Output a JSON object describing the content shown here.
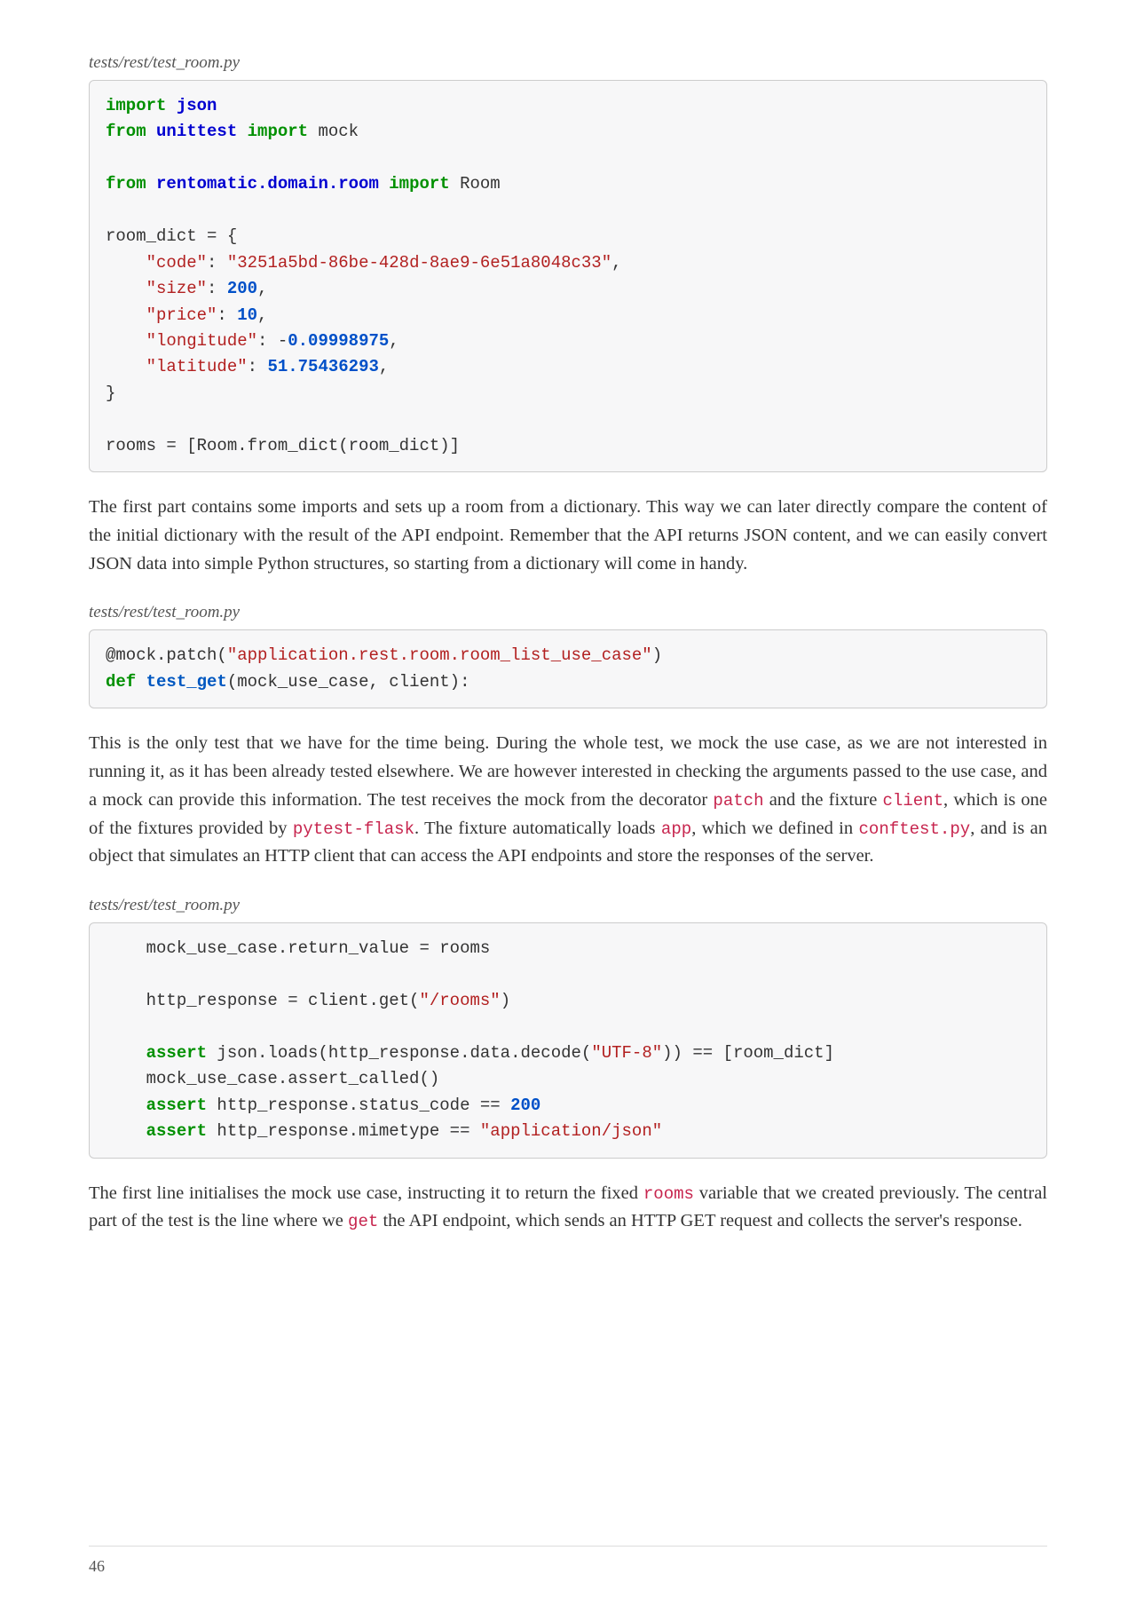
{
  "file_path_1": "tests/rest/test_room.py",
  "code_block_1": {
    "l1_import": "import",
    "l1_json": "json",
    "l2_from": "from",
    "l2_unittest": "unittest",
    "l2_import": "import",
    "l2_mock": "mock",
    "l4_from": "from",
    "l4_module": "rentomatic.domain.room",
    "l4_import": "import",
    "l4_room": "Room",
    "l6_var": "room_dict = {",
    "l7_key": "    \"code\"",
    "l7_colon": ": ",
    "l7_val": "\"3251a5bd-86be-428d-8ae9-6e51a8048c33\"",
    "l7_end": ",",
    "l8_key": "    \"size\"",
    "l8_colon": ": ",
    "l8_val": "200",
    "l8_end": ",",
    "l9_key": "    \"price\"",
    "l9_colon": ": ",
    "l9_val": "10",
    "l9_end": ",",
    "l10_key": "    \"longitude\"",
    "l10_colon": ": -",
    "l10_val": "0.09998975",
    "l10_end": ",",
    "l11_key": "    \"latitude\"",
    "l11_colon": ": ",
    "l11_val": "51.75436293",
    "l11_end": ",",
    "l12": "}",
    "l14": "rooms = [Room.from_dict(room_dict)]"
  },
  "paragraph_1": "The first part contains some imports and sets up a room from a dictionary. This way we can later directly compare the content of the initial dictionary with the result of the API endpoint. Remember that the API returns JSON content, and we can easily convert JSON data into simple Python structures, so starting from a dictionary will come in handy.",
  "file_path_2": "tests/rest/test_room.py",
  "code_block_2": {
    "l1_at": "@mock.patch(",
    "l1_str": "\"application.rest.room.room_list_use_case\"",
    "l1_close": ")",
    "l2_def": "def",
    "l2_name": " test_get",
    "l2_args": "(mock_use_case, client):"
  },
  "p2_text_1": "This is the only test that we have for the time being. During the whole test, we mock the use case, as we are not interested in running it, as it has been already tested elsewhere. We are however interested in checking the arguments passed to the use case, and a mock can provide this information. The test receives the mock from the decorator ",
  "p2_code_1": "patch",
  "p2_text_2": " and the fixture ",
  "p2_code_2": "client",
  "p2_text_3": ", which is one of the fixtures provided by ",
  "p2_code_3": "pytest-flask",
  "p2_text_4": ". The fixture automatically loads ",
  "p2_code_4": "app",
  "p2_text_5": ", which we defined in ",
  "p2_code_5": "conftest.py",
  "p2_text_6": ", and is an object that simulates an HTTP client that can access the API endpoints and store the responses of the server.",
  "file_path_3": "tests/rest/test_room.py",
  "code_block_3": {
    "l1": "    mock_use_case.return_value = rooms",
    "l3_a": "    http_response = client.get(",
    "l3_str": "\"/rooms\"",
    "l3_b": ")",
    "l5_assert": "    assert",
    "l5_a": " json.loads(http_response.data.decode(",
    "l5_str": "\"UTF-8\"",
    "l5_b": ")) == [room_dict]",
    "l6": "    mock_use_case.assert_called()",
    "l7_assert": "    assert",
    "l7_a": " http_response.status_code == ",
    "l7_num": "200",
    "l8_assert": "    assert",
    "l8_a": " http_response.mimetype == ",
    "l8_str": "\"application/json\""
  },
  "p3_text_1": "The first line initialises the mock use case, instructing it to return the fixed ",
  "p3_code_1": "rooms",
  "p3_text_2": " variable that we created previously. The central part of the test is the line where we ",
  "p3_code_2": "get",
  "p3_text_3": " the API endpoint, which sends an HTTP GET request and collects the server's response.",
  "page_number": "46"
}
